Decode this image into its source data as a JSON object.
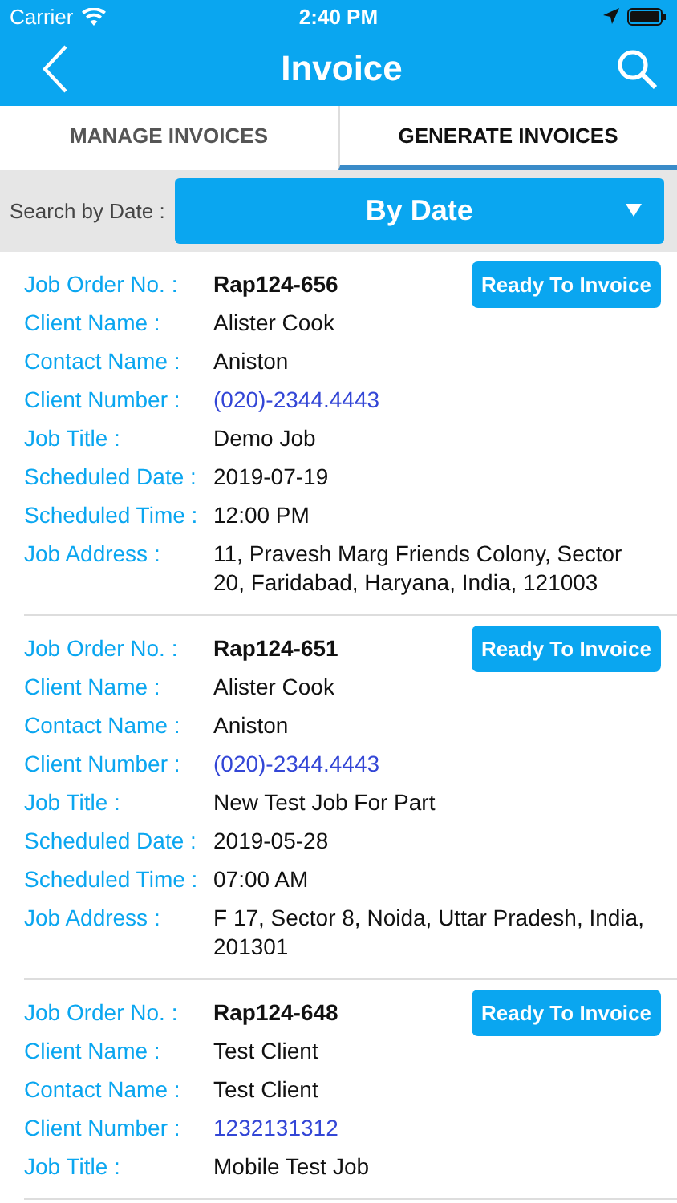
{
  "status_bar": {
    "carrier": "Carrier",
    "time": "2:40 PM"
  },
  "nav": {
    "title": "Invoice"
  },
  "tabs": [
    {
      "label": "MANAGE INVOICES",
      "selected": false
    },
    {
      "label": "GENERATE INVOICES",
      "selected": true
    }
  ],
  "filter": {
    "label": "Search by Date :",
    "value": "By Date"
  },
  "jobs": [
    {
      "button": "Ready To Invoice",
      "fields": [
        {
          "kind": "order",
          "label": "Job Order No. :",
          "value": "Rap124-656"
        },
        {
          "kind": "text",
          "label": "Client Name :",
          "value": "Alister Cook"
        },
        {
          "kind": "text",
          "label": "Contact Name :",
          "value": "Aniston"
        },
        {
          "kind": "link",
          "label": "Client Number :",
          "value": "(020)-2344.4443"
        },
        {
          "kind": "text",
          "label": "Job Title :",
          "value": "Demo Job"
        },
        {
          "kind": "text",
          "label": "Scheduled Date :",
          "value": "2019-07-19"
        },
        {
          "kind": "text",
          "label": "Scheduled Time :",
          "value": "12:00 PM"
        },
        {
          "kind": "text",
          "label": "Job Address :",
          "value": "11, Pravesh Marg Friends Colony, Sector 20, Faridabad, Haryana, India, 121003"
        }
      ]
    },
    {
      "button": "Ready To Invoice",
      "fields": [
        {
          "kind": "order",
          "label": "Job Order No. :",
          "value": "Rap124-651"
        },
        {
          "kind": "text",
          "label": "Client Name :",
          "value": "Alister Cook"
        },
        {
          "kind": "text",
          "label": "Contact Name :",
          "value": "Aniston"
        },
        {
          "kind": "link",
          "label": "Client Number :",
          "value": "(020)-2344.4443"
        },
        {
          "kind": "text",
          "label": "Job Title :",
          "value": "New Test Job For Part"
        },
        {
          "kind": "text",
          "label": "Scheduled Date :",
          "value": "2019-05-28"
        },
        {
          "kind": "text",
          "label": "Scheduled Time :",
          "value": "07:00 AM"
        },
        {
          "kind": "text",
          "label": "Job Address :",
          "value": "F 17, Sector 8, Noida, Uttar Pradesh, India, 201301"
        }
      ]
    },
    {
      "button": "Ready To Invoice",
      "fields": [
        {
          "kind": "order",
          "label": "Job Order No. :",
          "value": "Rap124-648"
        },
        {
          "kind": "text",
          "label": "Client Name :",
          "value": "Test Client"
        },
        {
          "kind": "text",
          "label": "Contact Name :",
          "value": "Test Client"
        },
        {
          "kind": "link",
          "label": "Client Number :",
          "value": "1232131312"
        },
        {
          "kind": "text",
          "label": "Job Title :",
          "value": "Mobile Test Job"
        }
      ]
    }
  ]
}
